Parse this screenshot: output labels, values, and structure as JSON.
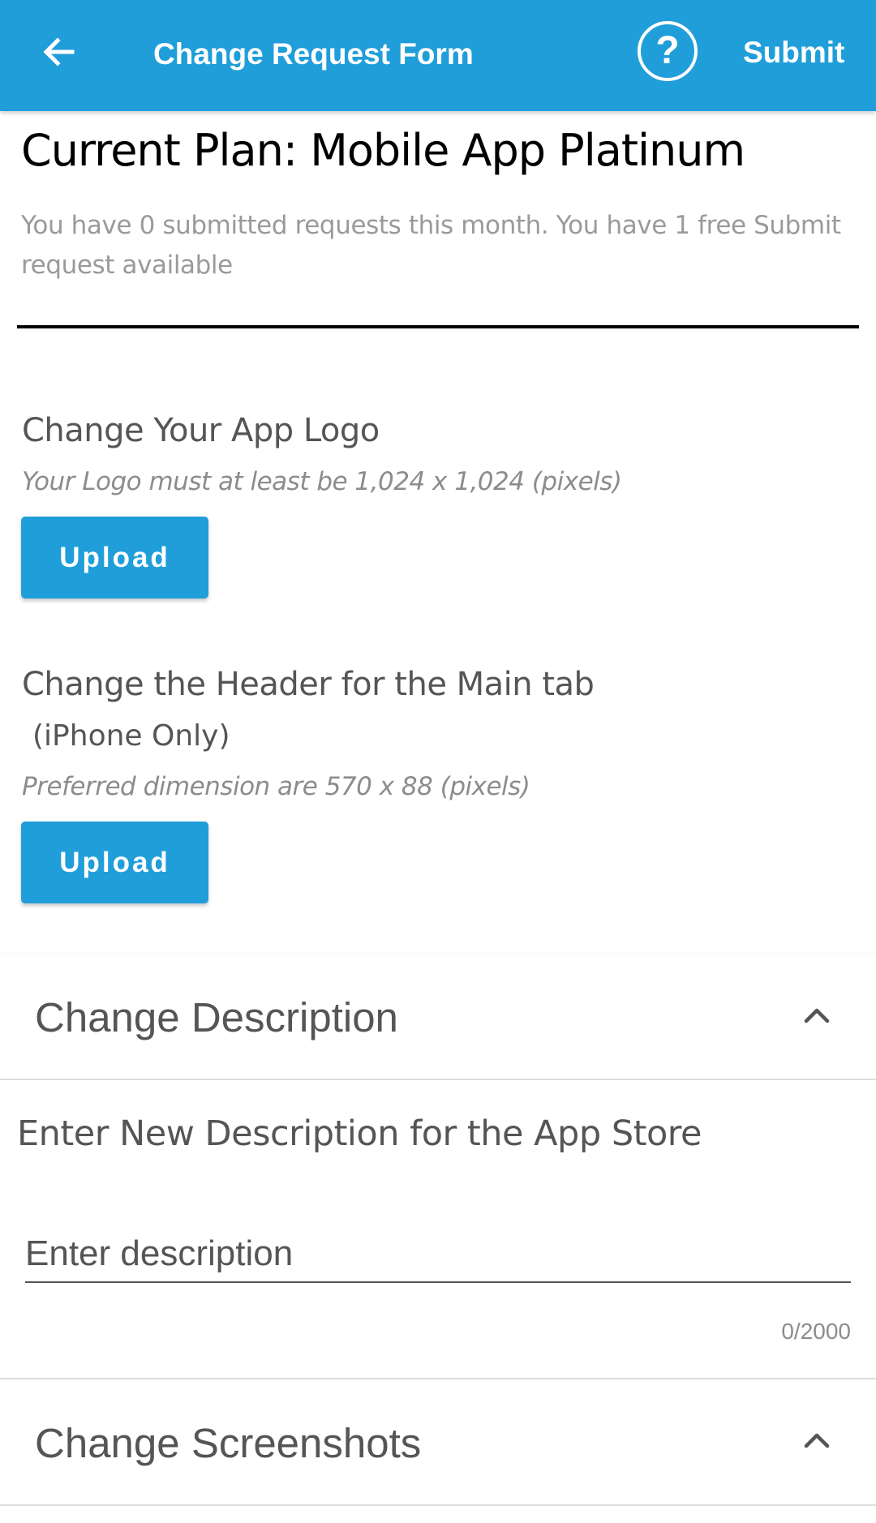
{
  "appbar": {
    "back_icon": "arrow-left-icon",
    "title": "Change Request Form",
    "help_icon": "question-circle-icon",
    "help_glyph": "?",
    "submit_label": "Submit",
    "color": "#209ed9"
  },
  "plan": {
    "title": "Current Plan:  Mobile App Platinum",
    "info": "You have 0 submitted requests this month. You have 1 free Submit request available"
  },
  "logo_section": {
    "heading": "Change Your App Logo",
    "hint": "Your Logo must at least be 1,024 x 1,024 (pixels)",
    "upload_label": "Upload"
  },
  "header_section": {
    "heading": "Change the Header for the Main tab",
    "subheading": "(iPhone Only)",
    "hint": "Preferred dimension are 570 x 88 (pixels)",
    "upload_label": "Upload"
  },
  "description_panel": {
    "title": "Change Description",
    "chevron_icon": "chevron-up-icon",
    "label": "Enter New Description for the App Store",
    "placeholder": "Enter description",
    "value": "",
    "counter": "0/2000"
  },
  "screenshots_panel": {
    "title": "Change Screenshots",
    "chevron_icon": "chevron-up-icon"
  }
}
